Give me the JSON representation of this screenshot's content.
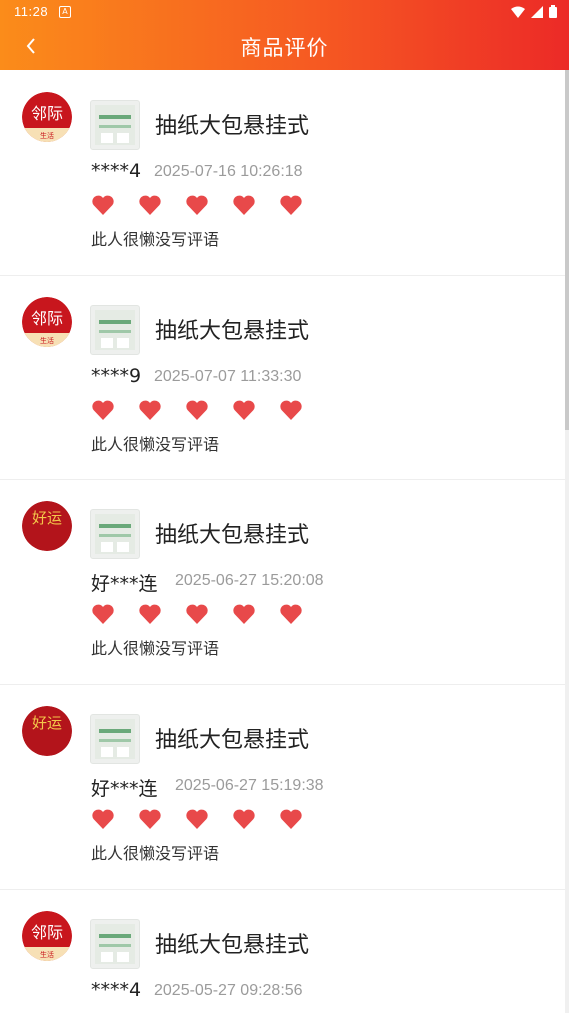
{
  "status": {
    "time": "11:28",
    "notif_glyph": "A"
  },
  "header": {
    "title": "商品评价",
    "back_icon": "chevron-left-icon"
  },
  "colors": {
    "header_start": "#fb8c1a",
    "header_end": "#ec2a27",
    "heart": "#e8494a",
    "timestamp": "#9b9b9b"
  },
  "reviews": [
    {
      "avatar": "linji-logo",
      "avatar_text": "邻际",
      "avatar_sub": "生活",
      "product": "抽纸大包悬挂式",
      "user": "****4",
      "time": "2025-07-16 10:26:18",
      "rating": 5,
      "comment": "此人很懒没写评语"
    },
    {
      "avatar": "linji-logo",
      "avatar_text": "邻际",
      "avatar_sub": "生活",
      "product": "抽纸大包悬挂式",
      "user": "****9",
      "time": "2025-07-07 11:33:30",
      "rating": 5,
      "comment": "此人很懒没写评语"
    },
    {
      "avatar": "haoyun-logo",
      "avatar_text": "好运",
      "product": "抽纸大包悬挂式",
      "user": "好***连",
      "time": "2025-06-27 15:20:08",
      "rating": 5,
      "comment": "此人很懒没写评语"
    },
    {
      "avatar": "haoyun-logo",
      "avatar_text": "好运",
      "product": "抽纸大包悬挂式",
      "user": "好***连",
      "time": "2025-06-27 15:19:38",
      "rating": 5,
      "comment": "此人很懒没写评语"
    },
    {
      "avatar": "linji-logo",
      "avatar_text": "邻际",
      "avatar_sub": "生活",
      "product": "抽纸大包悬挂式",
      "user": "****4",
      "time": "2025-05-27 09:28:56",
      "rating": null,
      "comment": ""
    }
  ]
}
